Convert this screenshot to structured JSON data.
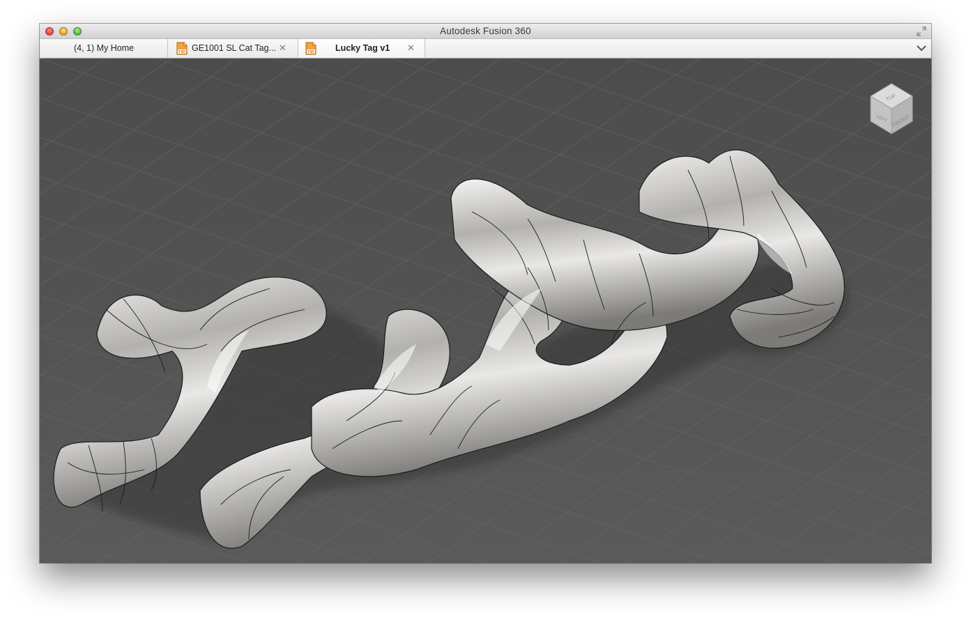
{
  "window": {
    "title": "Autodesk Fusion 360",
    "traffic_lights": [
      "close",
      "minimize",
      "zoom"
    ]
  },
  "tabs": [
    {
      "label": "(4, 1) My Home",
      "active": false,
      "icon": null,
      "closable": false
    },
    {
      "label": "GE1001 SL Cat Tag...",
      "active": false,
      "icon": "f3d-file-icon",
      "closable": true
    },
    {
      "label": "Lucky Tag v1",
      "active": true,
      "icon": "f3d-file-icon",
      "closable": true
    }
  ],
  "tab_close_glyph": "✕",
  "viewcube": {
    "top": "TOP",
    "front": "FRONT",
    "left": "LEFT"
  },
  "colors": {
    "viewport_background": "#555555",
    "model_surface": "#b9b7b4",
    "file_icon": "#e8821e"
  }
}
